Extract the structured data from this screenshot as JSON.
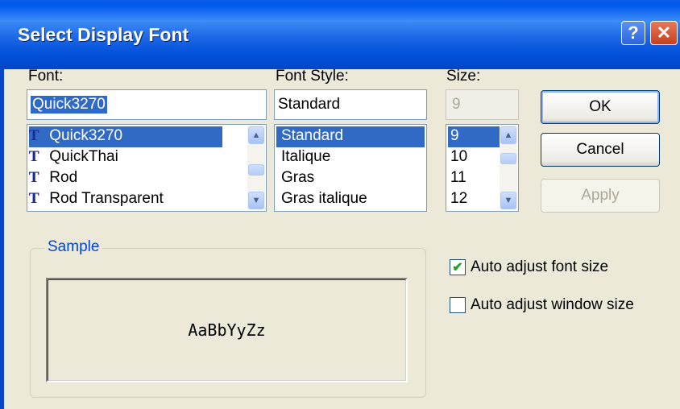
{
  "window": {
    "title": "Select Display Font",
    "help_label": "?",
    "close_label": "✕"
  },
  "font": {
    "label": "Font:",
    "value": "Quick3270",
    "items": [
      "Quick3270",
      "QuickThai",
      "Rod",
      "Rod Transparent"
    ],
    "selected_index": 0,
    "icon": "truetype-font-icon"
  },
  "style": {
    "label": "Font Style:",
    "value": "Standard",
    "items": [
      "Standard",
      "Italique",
      "Gras",
      "Gras italique"
    ],
    "selected_index": 0
  },
  "size": {
    "label": "Size:",
    "value": "9",
    "items": [
      "9",
      "10",
      "11",
      "12"
    ],
    "selected_index": 0
  },
  "buttons": {
    "ok": "OK",
    "cancel": "Cancel",
    "apply": "Apply"
  },
  "sample": {
    "label": "Sample",
    "text": "AaBbYyZz"
  },
  "options": {
    "auto_font": {
      "label": "Auto adjust font size",
      "checked": true
    },
    "auto_window": {
      "label": "Auto adjust window size",
      "checked": false
    }
  },
  "colors": {
    "titlebar": "#0058ee",
    "selection": "#316ac5",
    "group_title": "#0046d5"
  }
}
